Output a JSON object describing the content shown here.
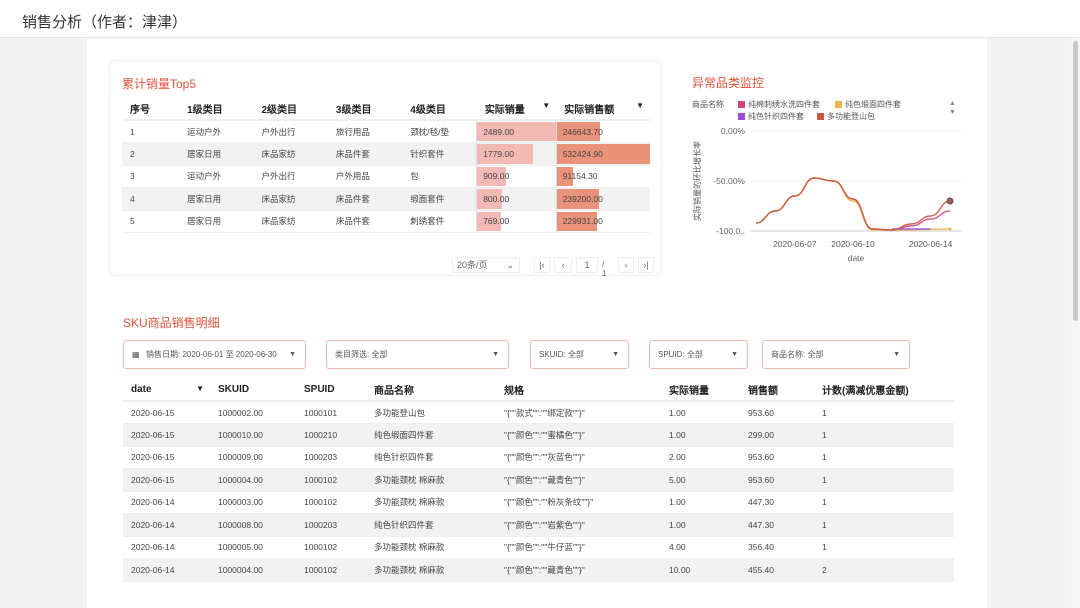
{
  "header": {
    "title": "销售分析（作者：津津）"
  },
  "top5": {
    "title": "累计销量Top5",
    "columns": [
      "序号",
      "1级类目",
      "2级类目",
      "3级类目",
      "4级类目",
      "实际销量",
      "实际销售额"
    ],
    "sort_icon": "caret-down-icon",
    "rows": [
      [
        "1",
        "运动户外",
        "户外出行",
        "旅行用品",
        "颈枕/毯/垫",
        "2489.00",
        "246643.70"
      ],
      [
        "2",
        "居家日用",
        "床品家纺",
        "床品件套",
        "针织套件",
        "1779.00",
        "532424.90"
      ],
      [
        "3",
        "运动户外",
        "户外出行",
        "户外用品",
        "包",
        "909.00",
        "91154.30"
      ],
      [
        "4",
        "居家日用",
        "床品家纺",
        "床品件套",
        "缎面套件",
        "800.00",
        "239200.00"
      ],
      [
        "5",
        "居家日用",
        "床品家纺",
        "床品件套",
        "刺绣套件",
        "769.00",
        "229931.00"
      ]
    ],
    "qty_max": 2489,
    "amt_max": 532424.9,
    "colors": {
      "qty_bar": "#f2b9b5",
      "amt_bar": "#e9937b"
    },
    "pager": {
      "page_size": "20条/页",
      "current": "1",
      "total": "/ 1"
    }
  },
  "chart_data": {
    "type": "line",
    "title": "异常品类监控",
    "legend_title": "商品名称",
    "legend_placement": "top",
    "xlabel": "date",
    "ylabel": "实际销量的环比增长率",
    "ylim": [
      -100,
      0
    ],
    "yticks": [
      "0.00%",
      "-50.00%",
      "-100.0.."
    ],
    "xrange": [
      "2020-06-05",
      "2020-06-15"
    ],
    "xticks": [
      "2020-06-07",
      "2020-06-10",
      "2020-06-14"
    ],
    "grid": true,
    "series": [
      {
        "name": "纯棉刺绣水洗四件套",
        "color": "#d0457a",
        "x": [
          "2020-06-05",
          "2020-06-06",
          "2020-06-07",
          "2020-06-08",
          "2020-06-09",
          "2020-06-10",
          "2020-06-11",
          "2020-06-12",
          "2020-06-13",
          "2020-06-14",
          "2020-06-15"
        ],
        "values": [
          -92,
          -80,
          -65,
          -47,
          -50,
          -68,
          -98,
          -99,
          -95,
          -88,
          -80
        ]
      },
      {
        "name": "纯色缎面四件套",
        "color": "#f0b24a",
        "x": [
          "2020-06-05",
          "2020-06-06",
          "2020-06-07",
          "2020-06-08",
          "2020-06-09",
          "2020-06-10",
          "2020-06-11",
          "2020-06-12",
          "2020-06-15"
        ],
        "values": [
          -92,
          -80,
          -65,
          -47,
          -50,
          -70,
          -99,
          -99,
          -98
        ]
      },
      {
        "name": "纯色针织四件套",
        "color": "#9b4fd6",
        "x": [
          "2020-06-12",
          "2020-06-13",
          "2020-06-14"
        ],
        "values": [
          -98,
          -98,
          -98
        ]
      },
      {
        "name": "多功能登山包",
        "color": "#c8573f",
        "x": [
          "2020-06-05",
          "2020-06-06",
          "2020-06-07",
          "2020-06-08",
          "2020-06-09",
          "2020-06-10",
          "2020-06-11",
          "2020-06-12",
          "2020-06-13",
          "2020-06-14",
          "2020-06-15"
        ],
        "values": [
          -92,
          -80,
          -65,
          -47,
          -50,
          -68,
          -98,
          -99,
          -93,
          -85,
          -70
        ]
      }
    ]
  },
  "sku": {
    "title": "SKU商品销售明细",
    "filters": [
      {
        "label": "销售日期: 2020-06-01 至 2020-06-30",
        "icon": "calendar-icon"
      },
      {
        "label": "类目筛选: 全部"
      },
      {
        "label": "SKUID: 全部"
      },
      {
        "label": "SPUID: 全部"
      },
      {
        "label": "商品名称: 全部"
      }
    ],
    "columns": [
      "date",
      "SKUID",
      "SPUID",
      "商品名称",
      "规格",
      "实际销量",
      "销售额",
      "计数(满减优惠金额)"
    ],
    "rows": [
      [
        "2020-06-15",
        "1000002.00",
        "1000101",
        "多功能登山包",
        "\"{\"\"款式\"\":\"\"绑定款\"\"}\"",
        "1.00",
        "953.60",
        "1"
      ],
      [
        "2020-06-15",
        "1000010.00",
        "1000210",
        "纯色缎面四件套",
        "\"{\"\"颜色\"\":\"\"蜜橘色\"\"}\"",
        "1.00",
        "299.00",
        "1"
      ],
      [
        "2020-06-15",
        "1000009.00",
        "1000203",
        "纯色针织四件套",
        "\"{\"\"颜色\"\":\"\"灰蓝色\"\"}\"",
        "2.00",
        "953.60",
        "1"
      ],
      [
        "2020-06-15",
        "1000004.00",
        "1000102",
        "多功能颈枕 棉麻款",
        "\"{\"\"颜色\"\":\"\"藏青色\"\"}\"",
        "5.00",
        "953.60",
        "1"
      ],
      [
        "2020-06-14",
        "1000003.00",
        "1000102",
        "多功能颈枕 棉麻款",
        "\"{\"\"颜色\"\":\"\"粉灰条纹\"\"}\"",
        "1.00",
        "447.30",
        "1"
      ],
      [
        "2020-06-14",
        "1000008.00",
        "1000203",
        "纯色针织四件套",
        "\"{\"\"颜色\"\":\"\"岩紫色\"\"}\"",
        "1.00",
        "447.30",
        "1"
      ],
      [
        "2020-06-14",
        "1000005.00",
        "1000102",
        "多功能颈枕 棉麻款",
        "\"{\"\"颜色\"\":\"\"牛仔蓝\"\"}\"",
        "4.00",
        "356.40",
        "1"
      ],
      [
        "2020-06-14",
        "1000004.00",
        "1000102",
        "多功能颈枕 棉麻款",
        "\"{\"\"颜色\"\":\"\"藏青色\"\"}\"",
        "10.00",
        "455.40",
        "2"
      ]
    ]
  }
}
